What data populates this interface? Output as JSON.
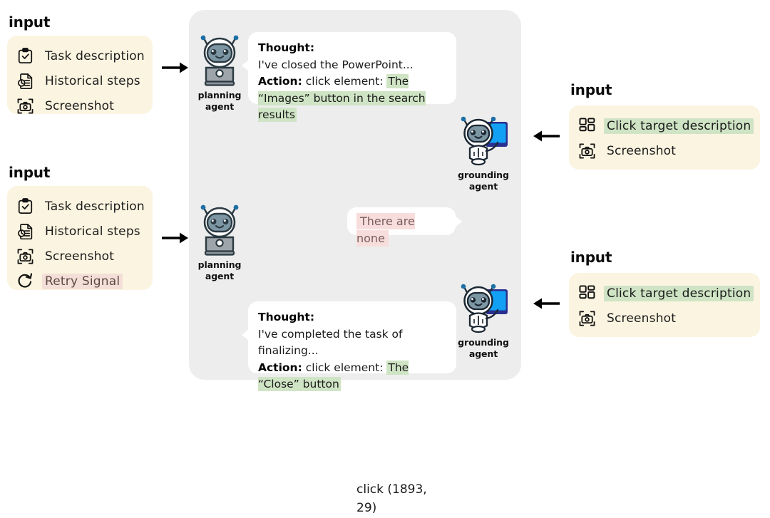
{
  "colors": {
    "panel_bg": "#EDEDED",
    "card_bg": "#FBF4E0",
    "highlight_green": "#CFE4C4",
    "highlight_pink": "#F7DEDC",
    "bubble_bg": "#FFFFFF",
    "text": "#1A1A1A",
    "arrow": "#000000"
  },
  "left_inputs": [
    {
      "caption": "input",
      "items": [
        {
          "icon": "clipboard-check-icon",
          "label": "Task description",
          "highlight": "none"
        },
        {
          "icon": "document-clock-icon",
          "label": "Historical steps",
          "highlight": "none"
        },
        {
          "icon": "screenshot-camera-icon",
          "label": "Screenshot",
          "highlight": "none"
        }
      ]
    },
    {
      "caption": "input",
      "items": [
        {
          "icon": "clipboard-check-icon",
          "label": "Task description",
          "highlight": "none"
        },
        {
          "icon": "document-clock-icon",
          "label": "Historical steps",
          "highlight": "none"
        },
        {
          "icon": "screenshot-camera-icon",
          "label": "Screenshot",
          "highlight": "none"
        },
        {
          "icon": "retry-refresh-icon",
          "label": "Retry Signal",
          "highlight": "pink"
        }
      ]
    }
  ],
  "right_inputs": [
    {
      "caption": "input",
      "items": [
        {
          "icon": "grid-blocks-icon",
          "label": "Click target description",
          "highlight": "green"
        },
        {
          "icon": "screenshot-camera-icon",
          "label": "Screenshot",
          "highlight": "none"
        }
      ]
    },
    {
      "caption": "input",
      "items": [
        {
          "icon": "grid-blocks-icon",
          "label": "Click target description",
          "highlight": "green"
        },
        {
          "icon": "screenshot-camera-icon",
          "label": "Screenshot",
          "highlight": "none"
        }
      ]
    }
  ],
  "turns": [
    {
      "agent": {
        "icon": "planning-agent-robot-icon",
        "name_line1": "planning",
        "name_line2": "agent"
      },
      "message": {
        "thought_label": "Thought:",
        "thought_text": "I've closed the PowerPoint...",
        "action_label": "Action:",
        "action_prefix": "click element:",
        "action_target": "The “Images” button in the search results",
        "target_highlight": "green"
      }
    },
    {
      "agent": {
        "icon": "grounding-agent-robot-icon",
        "name_line1": "grounding",
        "name_line2": "agent"
      },
      "message": {
        "text": "There are none",
        "highlight": "pink"
      }
    },
    {
      "agent": {
        "icon": "planning-agent-robot-icon",
        "name_line1": "planning",
        "name_line2": "agent"
      },
      "message": {
        "thought_label": "Thought:",
        "thought_text": "I've completed the task of finalizing...",
        "action_label": "Action:",
        "action_prefix": "click element:",
        "action_target": "The “Close” button",
        "target_highlight": "green"
      }
    },
    {
      "agent": {
        "icon": "grounding-agent-robot-icon",
        "name_line1": "grounding",
        "name_line2": "agent"
      },
      "message": {
        "text": "click (1893, 29)",
        "highlight": "none"
      }
    }
  ],
  "arrows": [
    {
      "name": "arrow-input-to-planning-1",
      "direction": "right"
    },
    {
      "name": "arrow-input-to-planning-2",
      "direction": "right"
    },
    {
      "name": "arrow-input-to-grounding-1",
      "direction": "left"
    },
    {
      "name": "arrow-input-to-grounding-2",
      "direction": "left"
    }
  ]
}
